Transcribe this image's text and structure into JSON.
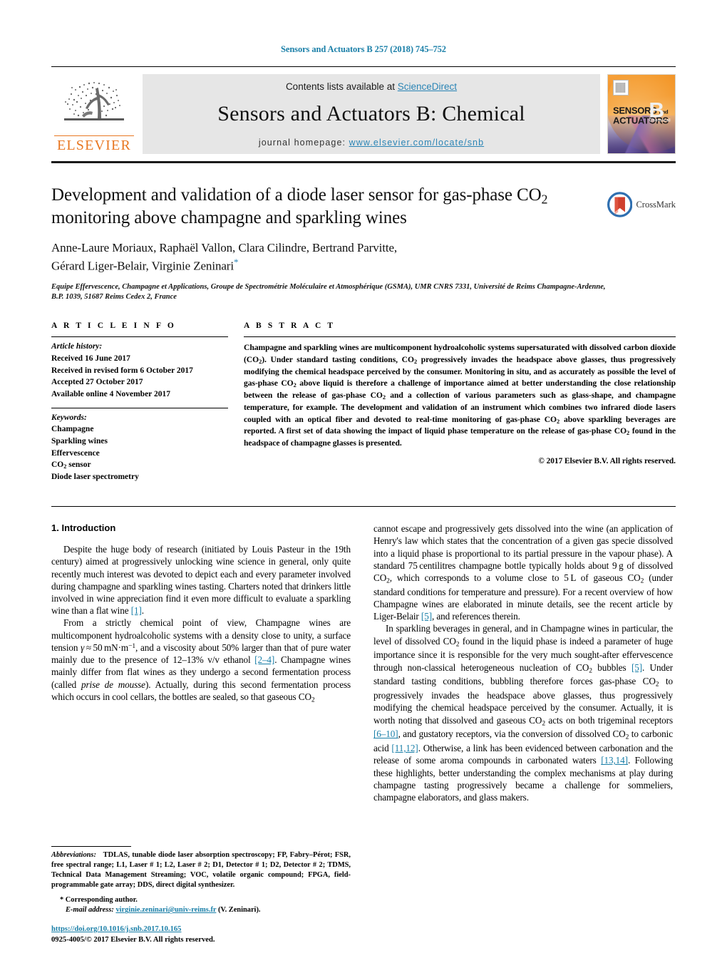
{
  "running_head": "Sensors and Actuators B 257 (2018) 745–752",
  "masthead": {
    "publisher_logo_word": "ELSEVIER",
    "contents_prefix": "Contents lists available at ",
    "contents_link": "ScienceDirect",
    "journal_title": "Sensors and Actuators B: Chemical",
    "homepage_prefix": "journal homepage: ",
    "homepage_url": "www.elsevier.com/locate/snb",
    "cover": {
      "line1": "SENSORS",
      "and": "and",
      "line2": "ACTUATORS",
      "letter": "B",
      "letter_sub": "Chemical"
    }
  },
  "article": {
    "title": "Development and validation of a diode laser sensor for gas-phase CO₂ monitoring above champagne and sparkling wines",
    "title_line1_a": "Development and validation of a diode laser sensor for gas-phase CO",
    "title_line1_sub": "2",
    "title_line2": "monitoring above champagne and sparkling wines",
    "authors_line1": "Anne-Laure Moriaux, Raphaël Vallon, Clara Cilindre, Bertrand Parvitte,",
    "authors_line2": "Gérard Liger-Belair, Virginie Zeninari",
    "author_star": "*",
    "affiliation": "Equipe Effervescence, Champagne et Applications, Groupe de Spectrométrie Moléculaire et Atmosphérique (GSMA), UMR CNRS 7331, Université de Reims Champagne-Ardenne, B.P. 1039, 51687 Reims Cedex 2, France",
    "crossmark_label": "CrossMark"
  },
  "article_info": {
    "label": "A R T I C L E   I N F O",
    "history_head": "Article history:",
    "history": [
      "Received 16 June 2017",
      "Received in revised form 6 October 2017",
      "Accepted 27 October 2017",
      "Available online 4 November 2017"
    ],
    "keywords_head": "Keywords:",
    "keywords": [
      "Champagne",
      "Sparkling wines",
      "Effervescence",
      "CO2 sensor",
      "Diode laser spectrometry"
    ],
    "keyword_co2_a": "CO",
    "keyword_co2_sub": "2",
    "keyword_co2_b": " sensor"
  },
  "abstract": {
    "label": "A B S T R A C T",
    "paragraphs": [
      "Champagne and sparkling wines are multicomponent hydroalcoholic systems supersaturated with dissolved carbon dioxide (CO2). Under standard tasting conditions, CO2 progressively invades the headspace above glasses, thus progressively modifying the chemical headspace perceived by the consumer. Monitoring in situ, and as accurately as possible the level of gas-phase CO2 above liquid is therefore a challenge of importance aimed at better understanding the close relationship between the release of gas-phase CO2 and a collection of various parameters such as glass-shape, and champagne temperature, for example. The development and validation of an instrument which combines two infrared diode lasers coupled with an optical fiber and devoted to real-time monitoring of gas-phase CO2 above sparkling beverages are reported. A first set of data showing the impact of liquid phase temperature on the release of gas-phase CO2 found in the headspace of champagne glasses is presented."
    ],
    "copyright": "© 2017 Elsevier B.V. All rights reserved."
  },
  "body": {
    "section_heading": "1.  Introduction",
    "left_paragraphs": [
      "Despite the huge body of research (initiated by Louis Pasteur in the 19th century) aimed at progressively unlocking wine science in general, only quite recently much interest was devoted to depict each and every parameter involved during champagne and sparkling wines tasting. Charters noted that drinkers little involved in wine appreciation find it even more difficult to evaluate a sparkling wine than a flat wine [1].",
      "From a strictly chemical point of view, Champagne wines are multicomponent hydroalcoholic systems with a density close to unity, a surface tension γ ≈ 50 mN·m−1, and a viscosity about 50% larger than that of pure water mainly due to the presence of 12–13% v/v ethanol [2–4]. Champagne wines mainly differ from flat wines as they undergo a second fermentation process (called prise de mousse). Actually, during this second fermentation process which occurs in cool cellars, the bottles are sealed, so that gaseous CO2"
    ],
    "right_paragraphs": [
      "cannot escape and progressively gets dissolved into the wine (an application of Henry's law which states that the concentration of a given gas specie dissolved into a liquid phase is proportional to its partial pressure in the vapour phase). A standard 75 centilitres champagne bottle typically holds about 9 g of dissolved CO2, which corresponds to a volume close to 5 L of gaseous CO2 (under standard conditions for temperature and pressure). For a recent overview of how Champagne wines are elaborated in minute details, see the recent article by Liger-Belair [5], and references therein.",
      "In sparkling beverages in general, and in Champagne wines in particular, the level of dissolved CO2 found in the liquid phase is indeed a parameter of huge importance since it is responsible for the very much sought-after effervescence through non-classical heterogeneous nucleation of CO2 bubbles [5]. Under standard tasting conditions, bubbling therefore forces gas-phase CO2 to progressively invades the headspace above glasses, thus progressively modifying the chemical headspace perceived by the consumer. Actually, it is worth noting that dissolved and gaseous CO2 acts on both trigeminal receptors [6–10], and gustatory receptors, via the conversion of dissolved CO2 to carbonic acid [11,12]. Otherwise, a link has been evidenced between carbonation and the release of some aroma compounds in carbonated waters [13,14]. Following these highlights, better understanding the complex mechanisms at play during champagne tasting progressively became a challenge for sommeliers, champagne elaborators, and glass makers."
    ]
  },
  "footnotes": {
    "abbrev_head": "Abbreviations:",
    "abbrev_text": " TDLAS, tunable diode laser absorption spectroscopy; FP, Fabry–Pérot; FSR, free spectral range; L1, Laser # 1; L2, Laser # 2; D1, Detector # 1; D2, Detector # 2; TDMS, Technical Data Management Streaming; VOC, volatile organic compound; FPGA, field-programmable gate array; DDS, direct digital synthesizer.",
    "corresponding_star": "*",
    "corresponding": " Corresponding author.",
    "email_label": "E-mail address:",
    "email": "virginie.zeninari@univ-reims.fr",
    "email_suffix": " (V. Zeninari)."
  },
  "doi_block": {
    "doi": "https://doi.org/10.1016/j.snb.2017.10.165",
    "issn_line": "0925-4005/© 2017 Elsevier B.V. All rights reserved."
  },
  "colors": {
    "link": "#1a7fa8",
    "elsevier_orange": "#e87722",
    "sciencedirect_blue": "#2a84b5",
    "masthead_grey": "#e6e6e6"
  }
}
